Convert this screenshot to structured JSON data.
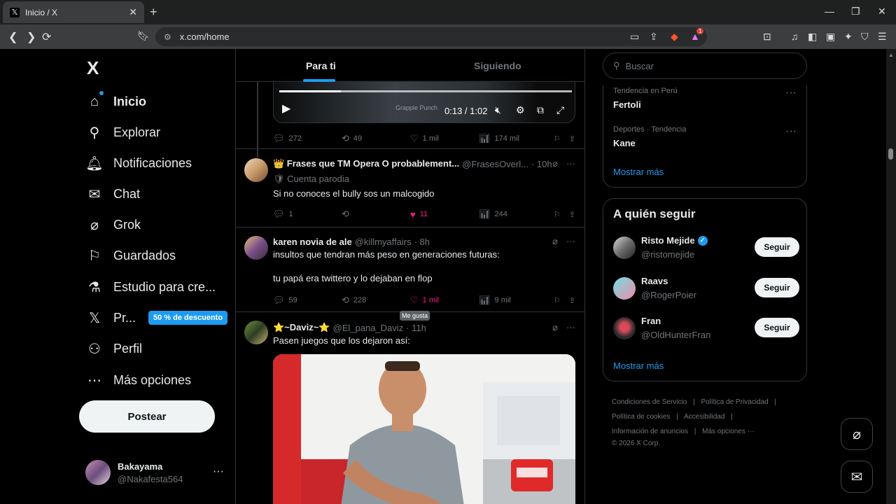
{
  "browser": {
    "tab_title": "Inicio / X",
    "tab_close": "✕",
    "new_tab": "+",
    "url": "x.com/home",
    "window_controls": [
      "—",
      "❐",
      "✕"
    ],
    "extension_count": "1"
  },
  "sidebar": {
    "logo": "X",
    "items": [
      {
        "label": "Inicio",
        "icon": "home-icon"
      },
      {
        "label": "Explorar",
        "icon": "search-icon"
      },
      {
        "label": "Notificaciones",
        "icon": "bell-icon"
      },
      {
        "label": "Chat",
        "icon": "mail-icon"
      },
      {
        "label": "Grok",
        "icon": "grok-icon"
      },
      {
        "label": "Guardados",
        "icon": "bookmark-icon"
      },
      {
        "label": "Estudio para cre...",
        "icon": "flask-icon"
      },
      {
        "label": "Pr...",
        "icon": "x-premium-icon",
        "badge": "50 % de descuento"
      },
      {
        "label": "Perfil",
        "icon": "user-icon"
      },
      {
        "label": "Más opciones",
        "icon": "more-circle-icon"
      }
    ],
    "post_button": "Postear",
    "user": {
      "name": "Bakayama",
      "handle": "@Nakafesta564",
      "more": "···"
    }
  },
  "timeline": {
    "tabs": [
      "Para ti",
      "Siguiendo"
    ],
    "active_tab": 0,
    "video": {
      "time": "0:13 / 1:02",
      "overlay_text": "Grapple Punch",
      "progress": 0.21
    },
    "posts": [
      {
        "stats": {
          "replies": "272",
          "reposts": "49",
          "likes": "1 mil",
          "views": "174 mil"
        }
      },
      {
        "name": "👑 Frases que TM Opera O probablement...",
        "handle": "@FrasesOverl...",
        "time": "· 10h",
        "parody": "🛡 Cuenta parodia",
        "text": "Si no conoces el bully sos un malcogido",
        "stats": {
          "replies": "1",
          "reposts": "",
          "likes": "11",
          "views": "244"
        },
        "liked": true
      },
      {
        "name": "karen novia de ale",
        "handle": "@killmyaffairs",
        "time": "· 8h",
        "text": "insultos que tendran más peso en generaciones futuras:",
        "text2": "tu papá era twittero y lo dejaban en flop",
        "stats": {
          "replies": "59",
          "reposts": "228",
          "likes": "1 mil",
          "views": "9 mil"
        },
        "tooltip": "Me gusta"
      },
      {
        "name": "⭐~Daviz~⭐",
        "handle": "@El_pana_Daviz",
        "time": "· 11h",
        "text": "Pasen juegos que los dejaron así:"
      }
    ]
  },
  "right": {
    "search_placeholder": "Buscar",
    "trends": [
      {
        "category": "Tendencia en Perú",
        "name": "Fertoli"
      },
      {
        "category": "Deportes · Tendencia",
        "name": "Kane"
      }
    ],
    "show_more": "Mostrar más",
    "who_to_follow": {
      "title": "A quién seguir",
      "users": [
        {
          "name": "Risto Mejide",
          "handle": "@ristomejide",
          "verified": true,
          "button": "Seguir"
        },
        {
          "name": "Raavs",
          "handle": "@RogerPoier",
          "verified": false,
          "button": "Seguir"
        },
        {
          "name": "Fran",
          "handle": "@OldHunterFran",
          "verified": false,
          "button": "Seguir"
        }
      ],
      "show_more": "Mostrar más"
    },
    "footer": {
      "links": [
        "Condiciones de Servicio",
        "|",
        "Política de Privacidad",
        "|",
        "Política de cookies",
        "|",
        "Accesibilidad",
        "|",
        "Información de anuncios",
        "|",
        "Más opciones ···"
      ],
      "copyright": "© 2026 X Corp."
    }
  },
  "colors": {
    "accent": "#1d9bf0",
    "like": "#f91880",
    "background": "#000000",
    "muted": "#71767b"
  }
}
